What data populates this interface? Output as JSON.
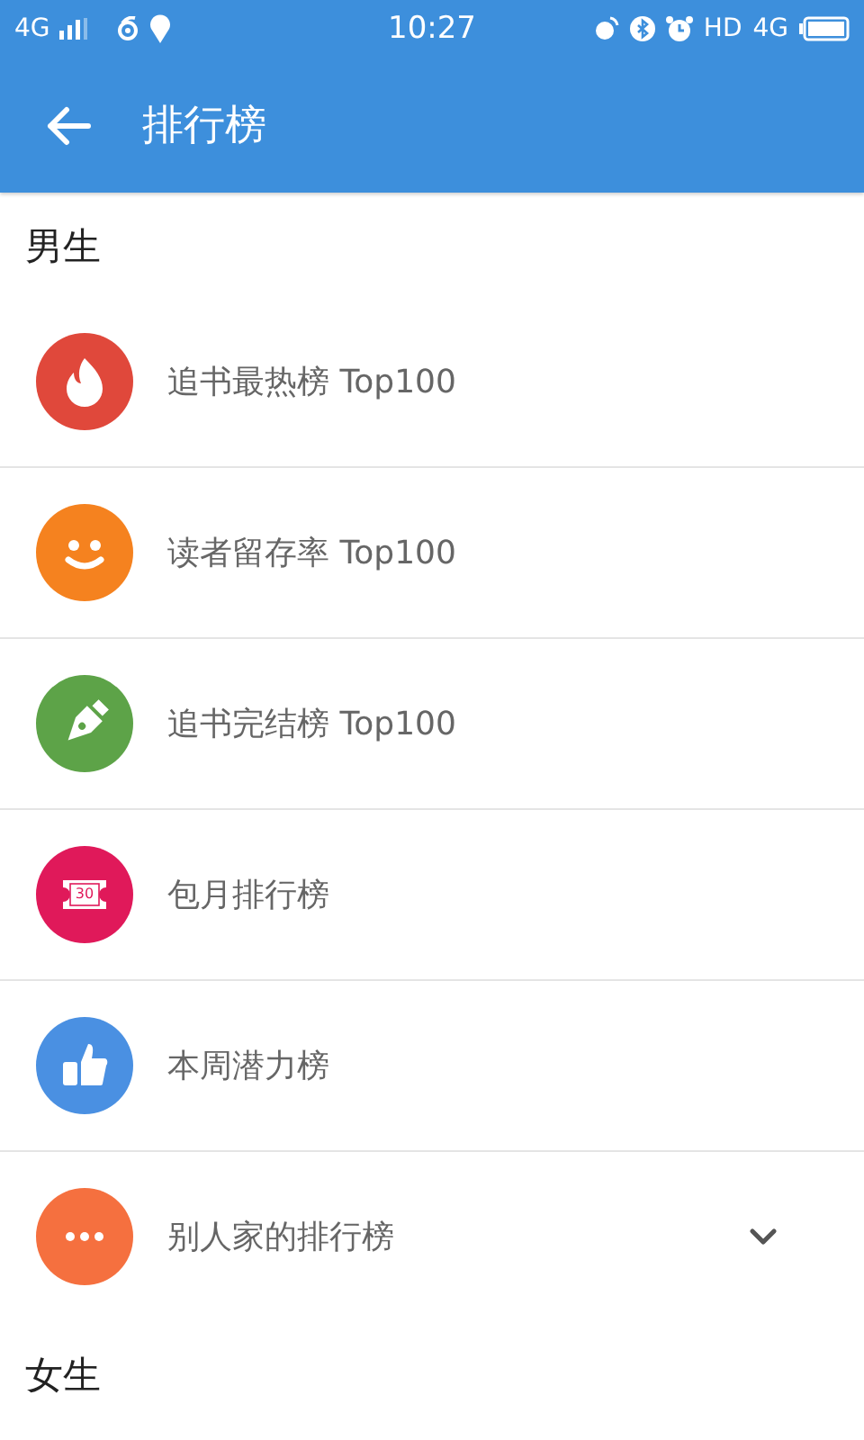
{
  "status_bar": {
    "network": "4G",
    "time": "10:27",
    "hd": "HD",
    "network_right": "4G"
  },
  "app_bar": {
    "title": "排行榜"
  },
  "sections": [
    {
      "title": "男生",
      "items": [
        {
          "label": "追书最热榜 Top100",
          "kind": "fire",
          "color": "#e0483b"
        },
        {
          "label": "读者留存率 Top100",
          "kind": "smile",
          "color": "#f5821f"
        },
        {
          "label": "追书完结榜 Top100",
          "kind": "pen",
          "color": "#5da348"
        },
        {
          "label": "包月排行榜",
          "kind": "ticket",
          "color": "#e0195a",
          "badge_text": "30"
        },
        {
          "label": "本周潜力榜",
          "kind": "thumb",
          "color": "#4a90e2"
        },
        {
          "label": "别人家的排行榜",
          "kind": "more",
          "color": "#f5703f",
          "expanded": false
        }
      ]
    },
    {
      "title": "女生"
    }
  ]
}
